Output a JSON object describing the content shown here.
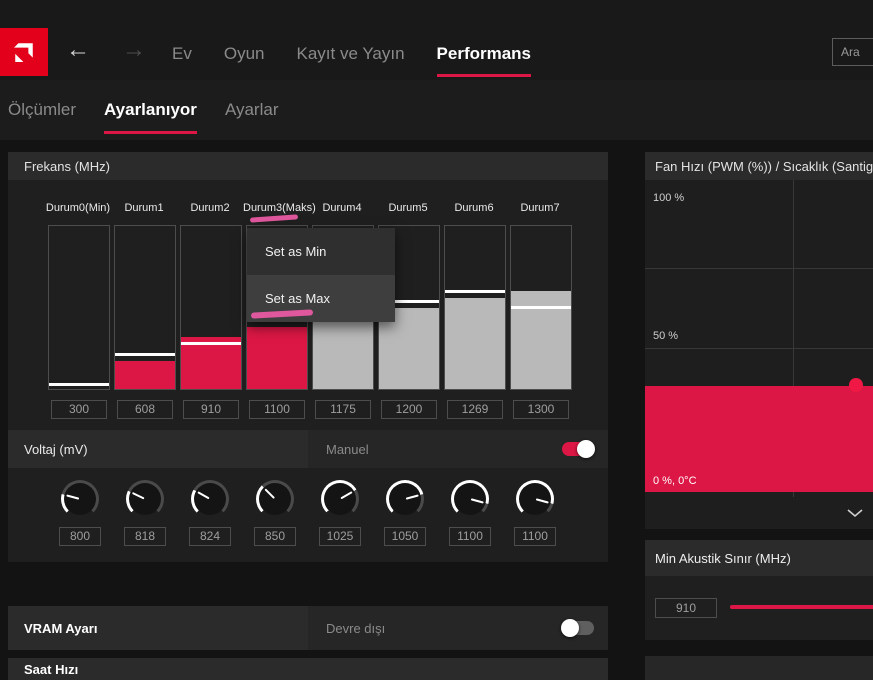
{
  "colors": {
    "accent": "#dc1745",
    "logo_red": "#e2001a",
    "marker_pink": "#e85aa2",
    "bar_red": "#dc1745",
    "bar_gray": "#b9b9b9"
  },
  "topbar": {
    "back_icon": "←",
    "forward_icon": "→",
    "items": [
      {
        "label": "Ev",
        "active": false
      },
      {
        "label": "Oyun",
        "active": false
      },
      {
        "label": "Kayıt ve Yayın",
        "active": false
      },
      {
        "label": "Performans",
        "active": true
      }
    ],
    "search_placeholder": "Ara"
  },
  "subnav": {
    "items": [
      {
        "label": "Ölçümler",
        "active": false
      },
      {
        "label": "Ayarlanıyor",
        "active": true
      },
      {
        "label": "Ayarlar",
        "active": false
      }
    ]
  },
  "frequency": {
    "title": "Frekans (MHz)",
    "bars": [
      {
        "label": "Durum0(Min)",
        "value": "300",
        "fill_pct": 0,
        "marker_pct": 2,
        "color": "red"
      },
      {
        "label": "Durum1",
        "value": "608",
        "fill_pct": 17,
        "marker_pct": 20,
        "color": "red"
      },
      {
        "label": "Durum2",
        "value": "910",
        "fill_pct": 32,
        "marker_pct": 27,
        "color": "red"
      },
      {
        "label": "Durum3(Maks)",
        "value": "1100",
        "fill_pct": 38,
        "marker_pct": null,
        "color": "red"
      },
      {
        "label": "Durum4",
        "value": "1175",
        "fill_pct": 42,
        "marker_pct": 45,
        "color": "gray"
      },
      {
        "label": "Durum5",
        "value": "1200",
        "fill_pct": 50,
        "marker_pct": 53,
        "color": "gray"
      },
      {
        "label": "Durum6",
        "value": "1269",
        "fill_pct": 56,
        "marker_pct": 59,
        "color": "gray"
      },
      {
        "label": "Durum7",
        "value": "1300",
        "fill_pct": 60,
        "marker_pct": 49,
        "color": "gray"
      }
    ],
    "context_menu": {
      "items": [
        {
          "label": "Set as Min",
          "highlighted": false
        },
        {
          "label": "Set as Max",
          "highlighted": true
        }
      ]
    }
  },
  "voltage": {
    "title": "Voltaj (mV)",
    "mode_label": "Manuel",
    "toggle_on": true,
    "knobs": [
      {
        "value": "800"
      },
      {
        "value": "818"
      },
      {
        "value": "824"
      },
      {
        "value": "850"
      },
      {
        "value": "1025"
      },
      {
        "value": "1050"
      },
      {
        "value": "1100"
      },
      {
        "value": "1100"
      }
    ]
  },
  "vram": {
    "title": "VRAM Ayarı",
    "status": "Devre dışı",
    "toggle_on": false
  },
  "clock": {
    "title": "Saat Hızı"
  },
  "fan": {
    "title": "Fan Hızı (PWM (%)) / Sıcaklık (Santigrat)",
    "label_100": "100 %",
    "label_50": "50 %",
    "label_0": "0 %, 0°C",
    "curve_pct": 37
  },
  "min_acoustic": {
    "title": "Min Akustik Sınır (MHz)",
    "value": "910"
  }
}
